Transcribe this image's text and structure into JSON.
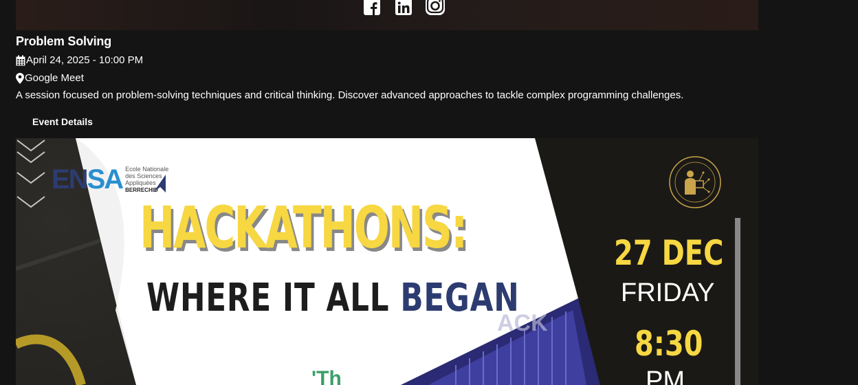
{
  "event": {
    "title": "Problem Solving",
    "date": "April 24, 2025 - 10:00 PM",
    "location": "Google Meet",
    "description": "A session focused on problem-solving techniques and critical thinking. Discover advanced approaches to tackle complex programming challenges.",
    "details_label": "Event Details"
  },
  "socials": [
    {
      "icon": "facebook-icon"
    },
    {
      "icon": "linkedin-icon"
    },
    {
      "icon": "instagram-icon"
    }
  ],
  "poster": {
    "logo_text_en": "EN",
    "logo_text_sa": "SA",
    "logo_line1": "Ecole Nationale",
    "logo_line2": "des Sciences",
    "logo_line3": "Appliquées",
    "logo_line4": "BERRECHID",
    "headline": "HACKATHONS:",
    "subline_part1": "WHERE IT ALL ",
    "subline_part2": "BEGAN",
    "date": "27 DEC",
    "day": "FRIDAY",
    "time": "8:30",
    "ampm": "PM",
    "colors": {
      "yellow": "#f7d742",
      "navy": "#2d3c70",
      "dark": "#1d1b18"
    }
  }
}
